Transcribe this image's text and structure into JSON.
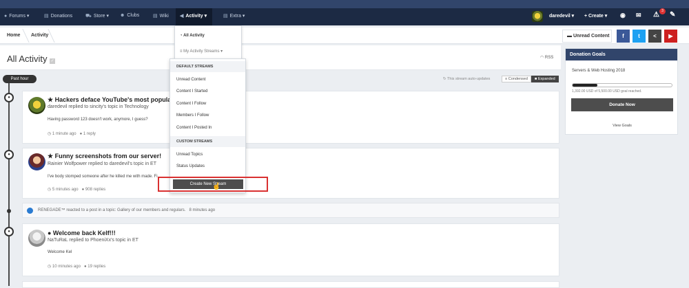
{
  "nav": {
    "items": [
      {
        "label": "Forums ▾",
        "icon": "chat-icon"
      },
      {
        "label": "Donations",
        "icon": "document-icon"
      },
      {
        "label": "Store ▾",
        "icon": "cart-icon"
      },
      {
        "label": "Clubs",
        "icon": "group-icon"
      },
      {
        "label": "Wiki",
        "icon": "document-icon"
      },
      {
        "label": "Activity ▾",
        "icon": "megaphone-icon"
      },
      {
        "label": "Extra ▾",
        "icon": "document-icon"
      }
    ],
    "user": "daredevil ▾",
    "create": "+ Create ▾",
    "notification_count": "3"
  },
  "breadcrumb": {
    "home": "Home",
    "current": "Activity"
  },
  "unread_content": "Unread Content",
  "social": [
    "f",
    "t",
    "<",
    "▶"
  ],
  "page": {
    "title": "All Activity",
    "rss": "RSS"
  },
  "stream": {
    "past_hour": "Past hour",
    "auto_updates": "This stream auto-updates",
    "condensed": "Condensed",
    "expanded": "Expanded"
  },
  "activity": [
    {
      "title": "★ Hackers deface YouTube's most popular",
      "sub": "daredevil replied to sincity's topic in Technology",
      "body": "Having password 123 doesn't work, anymore, I guess?",
      "time": "1 minute ago",
      "replies": "1 reply"
    },
    {
      "title": "★ Funny screenshots from our server!",
      "sub": "Rainier Wolfpower replied to daredevil's topic in ET",
      "body": "I've body stomped someone after he killed me with made. Fi",
      "time": "5 minutes ago",
      "replies": "908 replies"
    },
    {
      "title": "● Welcome back Kelf!!!",
      "sub": "NaTuRaL replied to PhoeniXx's topic in ET",
      "body": "Welcome Kel",
      "time": "10 minutes ago",
      "replies": "19 replies"
    }
  ],
  "reaction": {
    "text": "RENEGADE™ reacted to a post in a topic: Gallery of our members and regulars.",
    "time": "8 minutes ago"
  },
  "widget": {
    "title": "Donation Goals",
    "goal_name": "Servers & Web Hosting 2018",
    "progress_fraction": 0.25,
    "progress_text": "1,392.00 USD of 5,500.00 USD goal reached.",
    "donate": "Donate Now",
    "view_goals": "View Goals"
  },
  "dropdown": {
    "all_activity": "All Activity",
    "my_streams": "My Activity Streams",
    "default_header": "DEFAULT STREAMS",
    "default": [
      "Unread Content",
      "Content I Started",
      "Content I Follow",
      "Members I Follow",
      "Content I Posted In"
    ],
    "custom_header": "CUSTOM STREAMS",
    "custom": [
      "Unread Topics",
      "Status Updates"
    ],
    "create": "Create New Stream"
  }
}
